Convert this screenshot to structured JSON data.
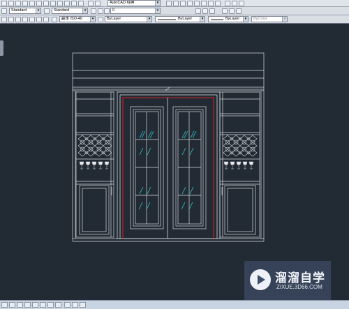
{
  "toolbar": {
    "workspace": "AutoCAD 经典",
    "text_style": "Standard",
    "dim_style": "Standard",
    "layer": "0",
    "multileader": "副本 ISO-40",
    "color": "ByLayer",
    "linetype": "ByLayer",
    "lineweight": "ByLayer",
    "plotstyle": "ByColor"
  },
  "watermark": {
    "title": "溜溜自学",
    "url": "ZIXUE.3D66.COM"
  }
}
